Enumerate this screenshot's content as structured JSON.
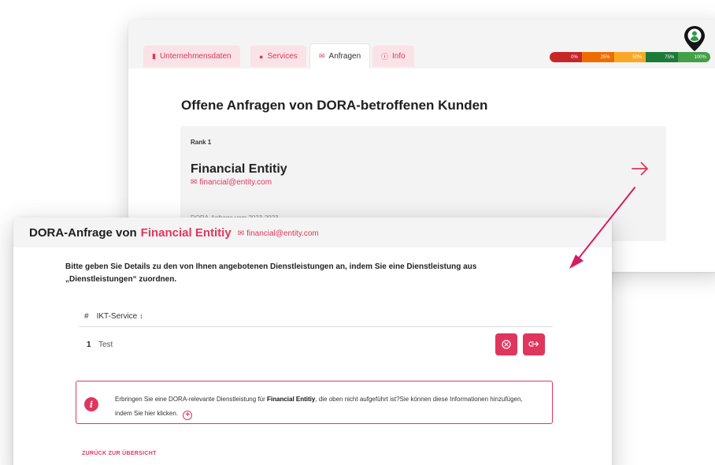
{
  "back_window": {
    "tabs": [
      {
        "label": "Unternehmensdaten",
        "icon": "building-icon"
      },
      {
        "label": "Services",
        "icon": "user-icon"
      },
      {
        "label": "Anfragen",
        "icon": "envelope-icon"
      },
      {
        "label": "Info",
        "icon": "info-icon"
      }
    ],
    "progress_segments": [
      {
        "label": "0%",
        "color": "#c62828"
      },
      {
        "label": "25%",
        "color": "#ef6c00"
      },
      {
        "label": "50%",
        "color": "#f9a825"
      },
      {
        "label": "75%",
        "color": "#1b7a3a"
      },
      {
        "label": "100%",
        "color": "#43a047"
      }
    ],
    "title": "Offene Anfragen von DORA-betroffenen Kunden",
    "rank_label": "Rank 1",
    "company": "Financial Entitiy",
    "email": "financial@entity.com",
    "faded_text": "DORA-Anfrage vom 2023-2023"
  },
  "modal": {
    "title_prefix": "DORA-Anfrage von",
    "company": "Financial Entitiy",
    "email": "financial@entity.com",
    "intro": "Bitte geben Sie Details zu den von Ihnen angebotenen Dienstleistungen an, indem Sie eine Dienstleistung aus „Dienstleistungen“ zuordnen.",
    "table": {
      "col_num": "#",
      "col_service": "IKT-Service",
      "sort_icon": "↕",
      "rows": [
        {
          "num": "1",
          "service": "Test"
        }
      ]
    },
    "info": {
      "text_before": "Erbringen Sie eine DORA-relevante Dienstleistung für",
      "company": "Financial Entitiy",
      "text_after": ", die oben nicht aufgeführt ist?Sie können diese Informationen hinzufügen, indem Sie hier klicken."
    },
    "back_link": "ZURÜCK ZUR ÜBERSICHT"
  },
  "colors": {
    "accent": "#e0365e",
    "connector": "#d81b60"
  }
}
